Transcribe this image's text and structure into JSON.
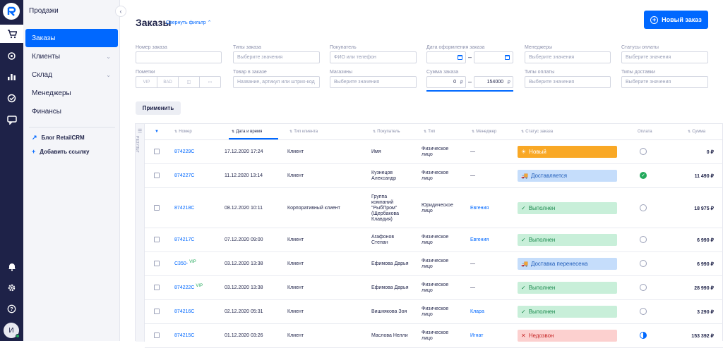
{
  "sidebar": {
    "title": "Продажи",
    "items": [
      {
        "label": "Заказы",
        "chev": ""
      },
      {
        "label": "Клиенты",
        "chev": "⌄"
      },
      {
        "label": "Склад",
        "chev": "⌄"
      },
      {
        "label": "Менеджеры",
        "chev": ""
      },
      {
        "label": "Финансы",
        "chev": ""
      }
    ],
    "blog_link": "Блог RetailCRM",
    "add_link": "Добавить ссылку",
    "avatar_letter": "И"
  },
  "page": {
    "title": "Заказы",
    "filter_toggle": "Свернуть фильтр",
    "new_order": "Новый заказ",
    "apply": "Применить"
  },
  "filters": {
    "order_number": {
      "label": "Номер заказа"
    },
    "order_types": {
      "label": "Типы заказа",
      "placeholder": "Выберите значения"
    },
    "buyer": {
      "label": "Покупатель",
      "placeholder": "ФИО или телефон"
    },
    "order_date": {
      "label": "Дата оформления заказа"
    },
    "managers": {
      "label": "Менеджеры",
      "placeholder": "Выберите значения"
    },
    "payment_status": {
      "label": "Статусы оплаты",
      "placeholder": "Выберите значения"
    },
    "marks": {
      "label": "Пометки",
      "options": [
        "VIP",
        "BAD",
        "◫",
        "▭"
      ]
    },
    "product": {
      "label": "Товар в заказе",
      "placeholder": "Название, артикул или штрих-код"
    },
    "shops": {
      "label": "Магазины",
      "placeholder": "Выберите значения"
    },
    "sum": {
      "label": "Сумма заказа",
      "from": "0",
      "to": "154000",
      "currency": "₽"
    },
    "payment_types": {
      "label": "Типы оплаты",
      "placeholder": "Выберите значения"
    },
    "delivery_types": {
      "label": "Типы доставки",
      "placeholder": "Выберите значения"
    }
  },
  "table": {
    "side_tab": "РЕЗУЛЬТ",
    "headers": [
      "Номер",
      "Дата и время",
      "Тип клиента",
      "Покупатель",
      "Тип",
      "Менеджер",
      "Статус заказа",
      "Оплата",
      "Сумма"
    ],
    "rows": [
      {
        "number": "874229C",
        "vip": "",
        "date": "17.12.2020 17:24",
        "client_type": "Клиент",
        "buyer": [
          "Имя"
        ],
        "type": [
          "Физическое",
          "лицо"
        ],
        "manager": "—",
        "status": "Новый",
        "status_kind": "new",
        "pay": "clock",
        "sum": "0 ₽"
      },
      {
        "number": "874227C",
        "vip": "",
        "date": "11.12.2020 13:14",
        "client_type": "Клиент",
        "buyer": [
          "Кузнецов",
          "Александр"
        ],
        "type": [
          "Физическое",
          "лицо"
        ],
        "manager": "—",
        "status": "Доставляется",
        "status_kind": "del",
        "pay": "ok",
        "sum": "11 490 ₽"
      },
      {
        "number": "874218C",
        "vip": "",
        "date": "08.12.2020 10:11",
        "client_type": "Корпоративный клиент",
        "buyer": [
          "Группа",
          "компаний",
          "\"РыбПром\"",
          "(Щербакова",
          "Клавдия)"
        ],
        "type": [
          "Юридическое",
          "лицо"
        ],
        "manager": "Евгения",
        "status": "Выполнен",
        "status_kind": "done",
        "pay": "clock",
        "sum": "18 975 ₽"
      },
      {
        "number": "874217C",
        "vip": "",
        "date": "07.12.2020 09:00",
        "client_type": "Клиент",
        "buyer": [
          "Агафонов",
          "Степан"
        ],
        "type": [
          "Физическое",
          "лицо"
        ],
        "manager": "Евгения",
        "status": "Выполнен",
        "status_kind": "done",
        "pay": "clock",
        "sum": "6 990 ₽"
      },
      {
        "number": "C350-",
        "vip": "VIP",
        "date": "03.12.2020 13:38",
        "client_type": "Клиент",
        "buyer": [
          "Ефимова Дарья"
        ],
        "type": [
          "Физическое",
          "лицо"
        ],
        "manager": "—",
        "status": "Доставка перенесена",
        "status_kind": "del",
        "pay": "clock",
        "sum": "6 990 ₽"
      },
      {
        "number": "874222C",
        "vip": "VIP",
        "date": "03.12.2020 13:38",
        "client_type": "Клиент",
        "buyer": [
          "Ефимова Дарья"
        ],
        "type": [
          "Физическое",
          "лицо"
        ],
        "manager": "—",
        "status": "Выполнен",
        "status_kind": "done",
        "pay": "clock",
        "sum": "28 990 ₽"
      },
      {
        "number": "874216C",
        "vip": "",
        "date": "02.12.2020 05:31",
        "client_type": "Клиент",
        "buyer": [
          "Вишнякова Зоя"
        ],
        "type": [
          "Физическое",
          "лицо"
        ],
        "manager": "Клара",
        "status": "Выполнен",
        "status_kind": "done",
        "pay": "clock",
        "sum": "3 290 ₽"
      },
      {
        "number": "874215C",
        "vip": "",
        "date": "01.12.2020 03:26",
        "client_type": "Клиент",
        "buyer": [
          "Маслова Нелли"
        ],
        "type": [
          "Физическое",
          "лицо"
        ],
        "manager": "Игнат",
        "status": "Недозвон",
        "status_kind": "fail",
        "pay": "half",
        "sum": "153 392 ₽"
      }
    ]
  }
}
